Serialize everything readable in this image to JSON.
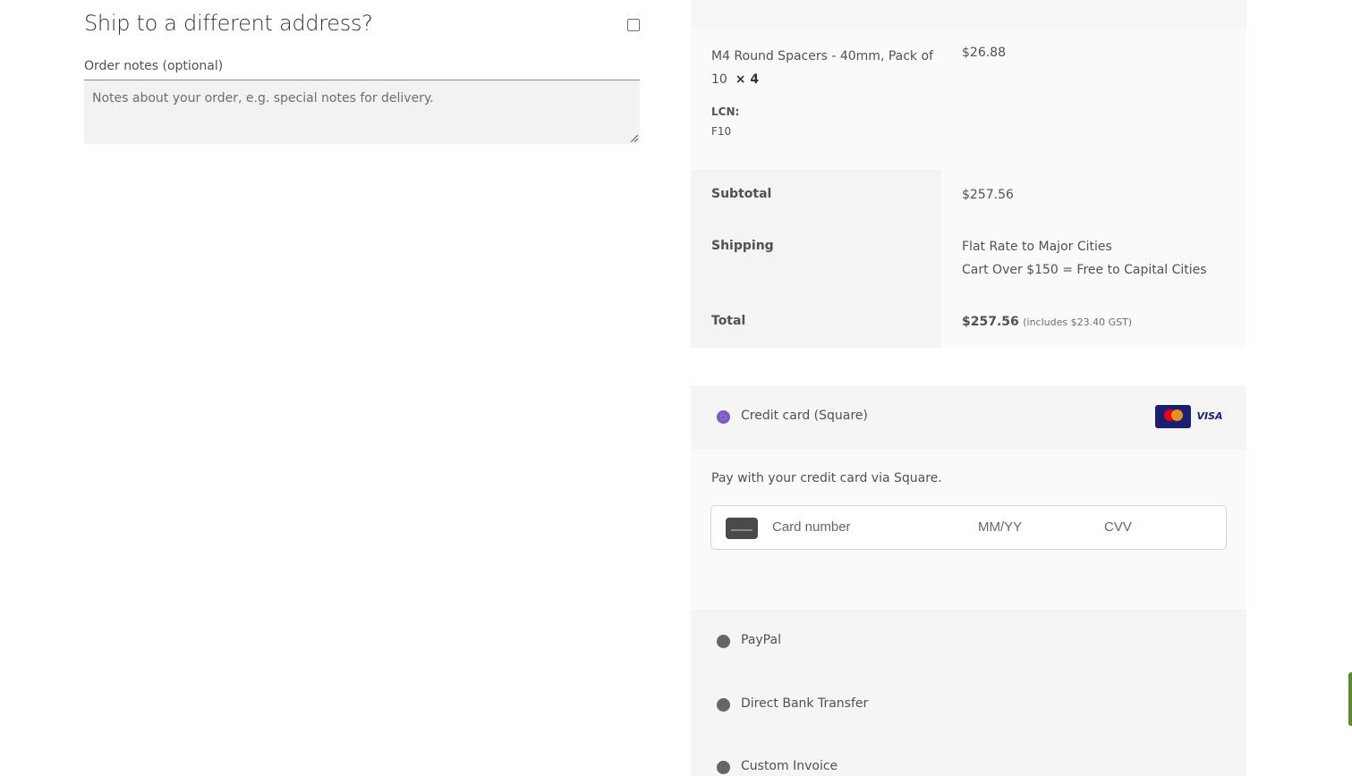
{
  "shipping": {
    "title": "Ship to a different address?",
    "checked": false
  },
  "order_notes": {
    "label": "Order notes (optional)",
    "placeholder": "Notes about your order, e.g. special notes for delivery.",
    "value": ""
  },
  "order_review": {
    "item": {
      "name": "M4 Round Spacers - 40mm, Pack of 10",
      "quantity": "× 4",
      "price": "$26.88",
      "meta_key": "LCN:",
      "meta_value": "F10"
    },
    "subtotal": {
      "label": "Subtotal",
      "value": "$257.56"
    },
    "shipping": {
      "label": "Shipping",
      "options": [
        "Flat Rate to Major Cities",
        "Cart Over $150 = Free to Capital Cities"
      ]
    },
    "total": {
      "label": "Total",
      "value": "$257.56",
      "tax_note": "(includes $23.40 GST)"
    }
  },
  "payment": {
    "methods": [
      {
        "label": "Credit card (Square)",
        "selected": true,
        "icons": [
          "mastercard-icon",
          "visa-icon"
        ]
      },
      {
        "label": "PayPal",
        "selected": false
      },
      {
        "label": "Direct Bank Transfer",
        "selected": false
      },
      {
        "label": "Custom Invoice",
        "selected": false
      }
    ],
    "cc_description": "Pay with your credit card via Square.",
    "card_field": {
      "number_placeholder": "Card number",
      "expiry_placeholder": "MM/YY",
      "cvv_placeholder": "CVV"
    },
    "visa_text": "VISA"
  },
  "colors": {
    "accent": "#7c5cbf",
    "panel_bg": "#f5f5f5",
    "text": "#515151"
  }
}
